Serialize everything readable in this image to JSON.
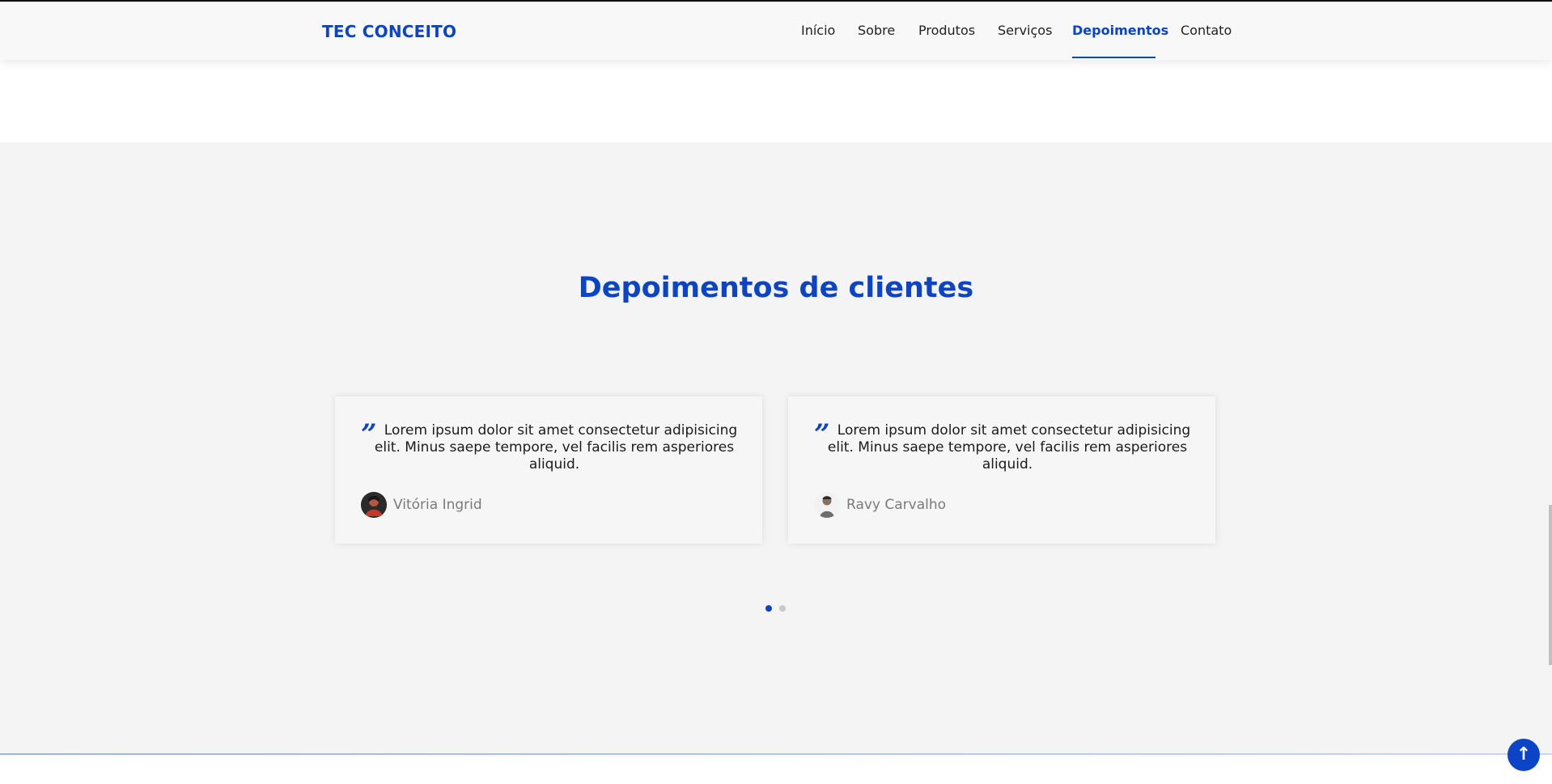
{
  "header": {
    "logo": "TEC CONCEITO",
    "nav": [
      "Início",
      "Sobre",
      "Produtos",
      "Serviços",
      "Depoimentos",
      "Contato"
    ],
    "active_item": "Depoimentos"
  },
  "testimonials": {
    "title": "Depoimentos de clientes",
    "cards": [
      {
        "quote": "Lorem ipsum dolor sit amet consectetur adipisicing elit. Minus saepe tempore, vel facilis rem asperiores aliquid.",
        "author": "Vitória Ingrid",
        "avatar_icon": "user-photo-icon"
      },
      {
        "quote": "Lorem ipsum dolor sit amet consectetur adipisicing elit. Minus saepe tempore, vel facilis rem asperiores aliquid.",
        "author": "Ravy Carvalho",
        "avatar_icon": "user-photo-icon"
      }
    ],
    "pagination": {
      "pages": 2,
      "current": 1
    }
  },
  "back_to_top": {
    "icon": "arrow-up-icon",
    "glyph": "↑"
  },
  "colors": {
    "accent": "#0c44c8",
    "section_bg": "#f4f4f4",
    "header_bg": "#f8f8f8"
  }
}
